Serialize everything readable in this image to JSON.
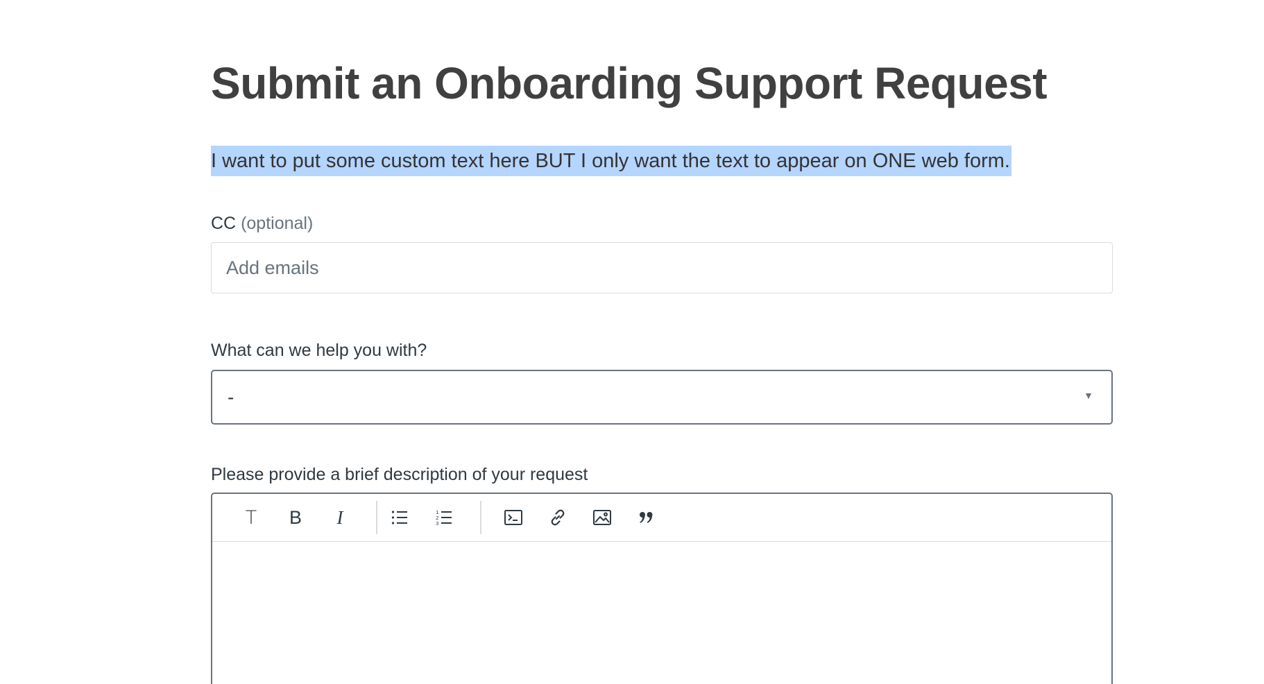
{
  "page": {
    "title": "Submit an Onboarding Support Request",
    "intro": "I want to put some custom text here BUT I only want the text to appear on ONE web form."
  },
  "cc": {
    "label": "CC",
    "optional": "(optional)",
    "placeholder": "Add emails"
  },
  "help": {
    "label": "What can we help you with?",
    "selected": "-"
  },
  "description": {
    "label": "Please provide a brief description of your request",
    "toolbar": {
      "text": "T",
      "bold": "B",
      "italic": "I"
    }
  },
  "colors": {
    "selection_highlight": "#b4d5fe",
    "heading": "#404040",
    "border_active": "#68737d",
    "border_default": "#d8dcde"
  }
}
